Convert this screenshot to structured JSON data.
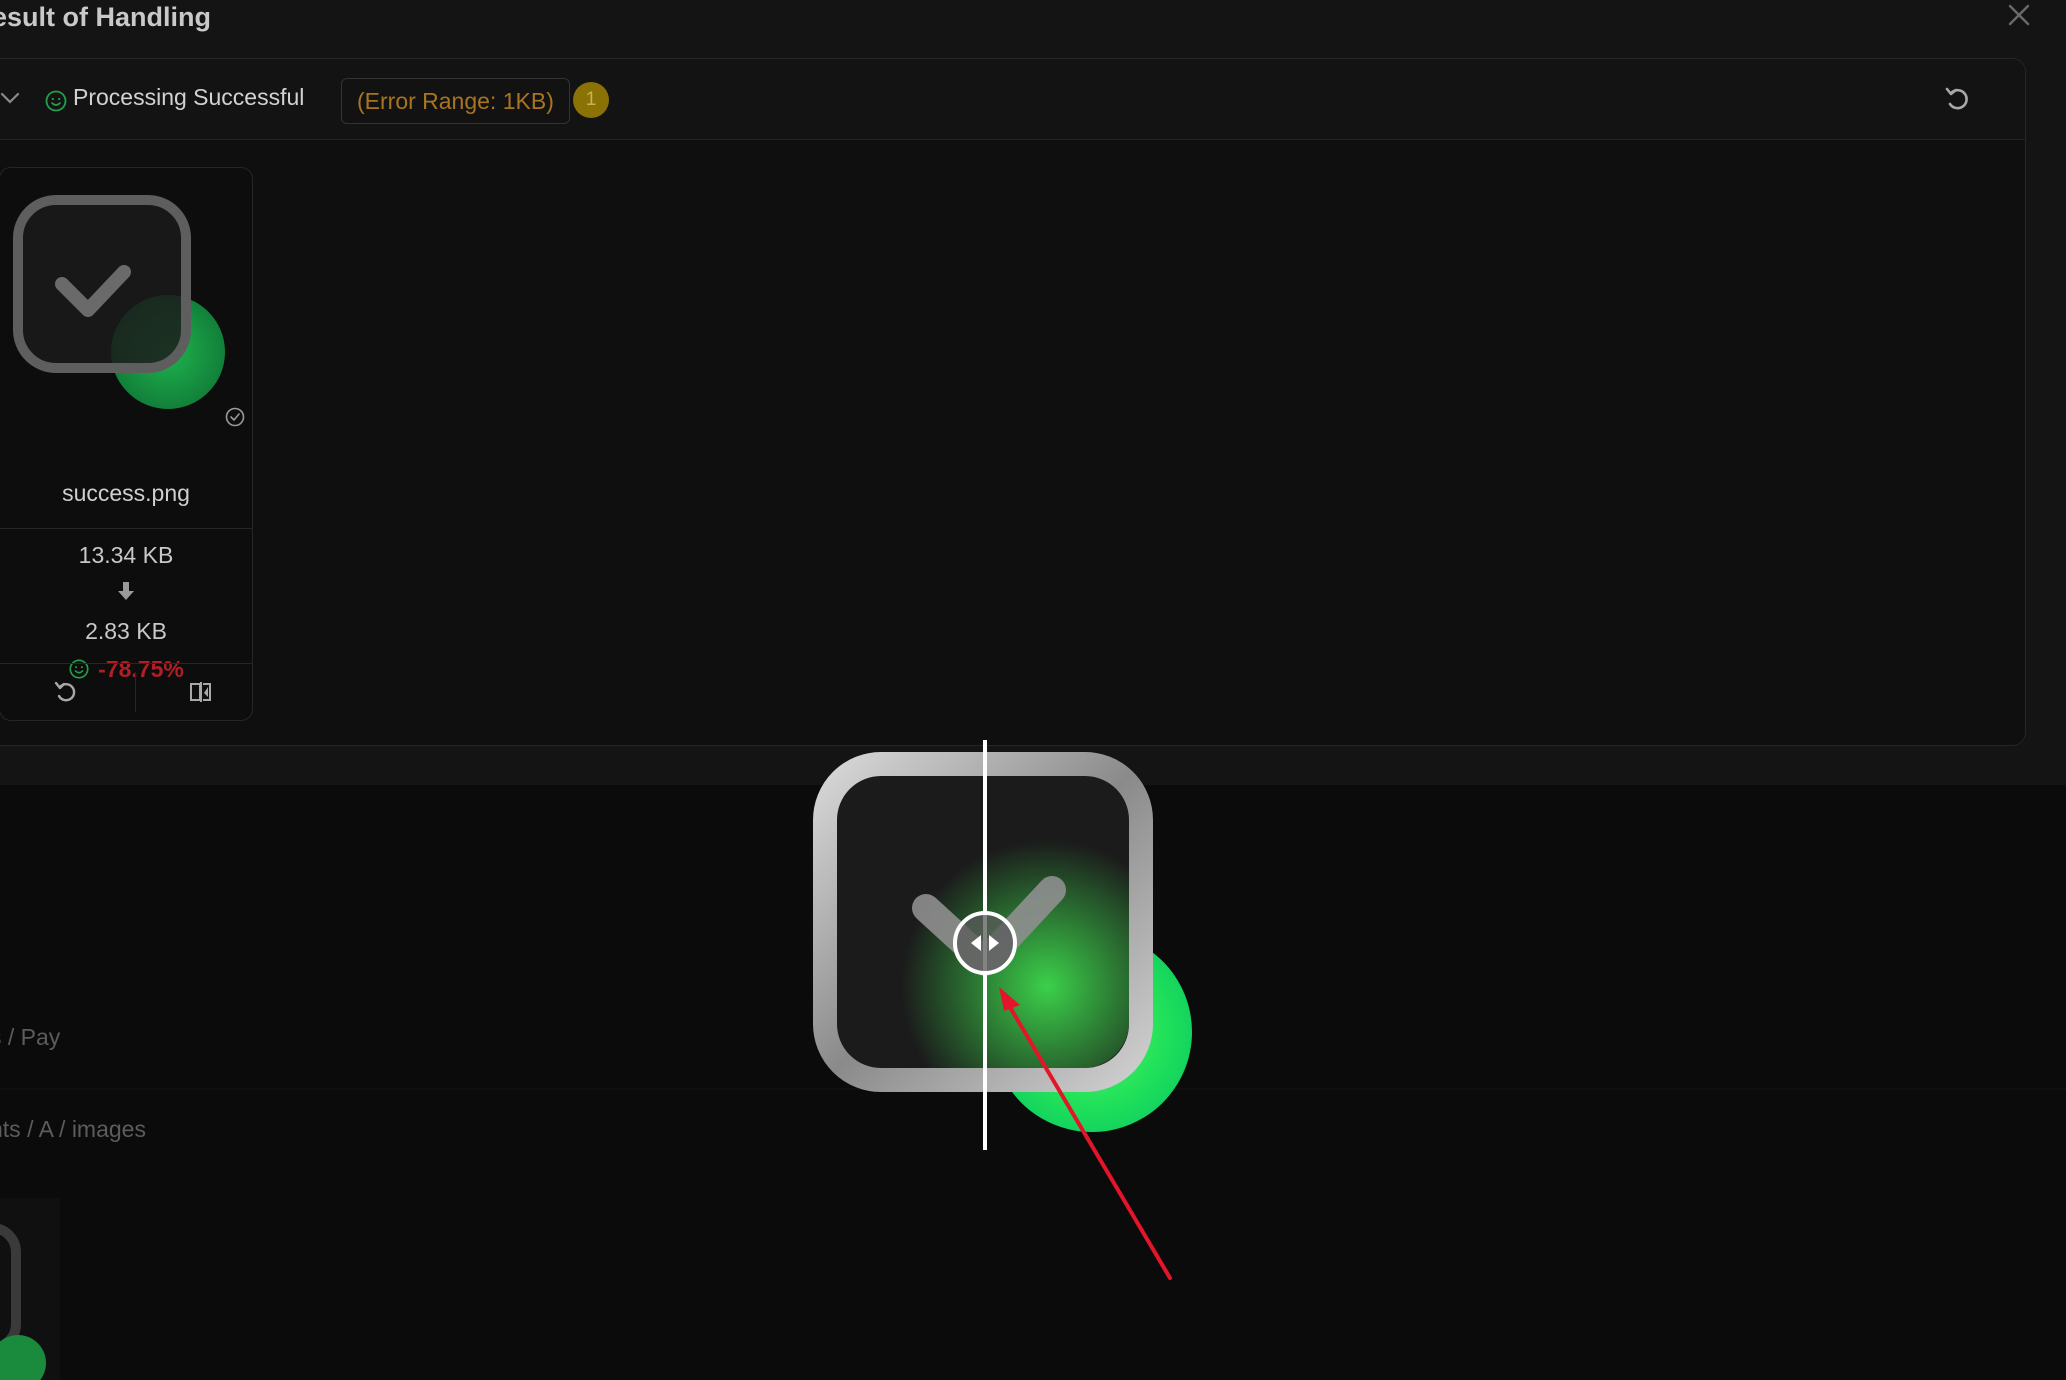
{
  "dialog": {
    "title": "esult of Handling"
  },
  "panel": {
    "status": "Processing Successful",
    "error_range": "(Error Range: 1KB)",
    "count": "1"
  },
  "card": {
    "file_name": "success.png",
    "size_before": "13.34 KB",
    "size_after": "2.83 KB",
    "reduction": "-78.75%"
  },
  "background": {
    "path1": "s / Pay",
    "path2": "nts / A / images"
  },
  "icons": {
    "close": "close-icon",
    "collapse": "chevron-down-icon",
    "status": "smile-icon",
    "reset": "undo-icon",
    "done": "check-circle-icon",
    "down_arrow": "arrow-down-icon",
    "compare": "compare-icon",
    "slider_handle": "left-right-arrows-icon"
  },
  "colors": {
    "accent_green": "#22c55e",
    "error_range": "#a9741f",
    "badge": "#8a7206",
    "reduction": "#b11e25",
    "annotation": "#e3152a"
  }
}
